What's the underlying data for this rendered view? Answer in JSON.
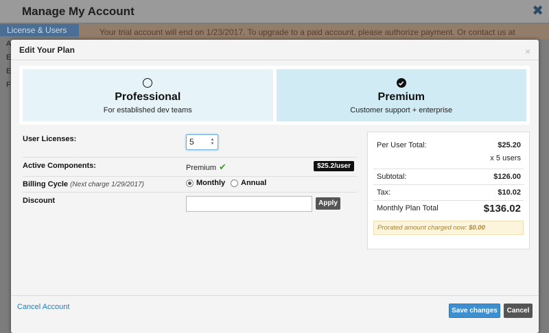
{
  "background": {
    "title": "Manage My Account",
    "close_glyph": "✖",
    "sidebar_active": "License & Users",
    "sidebar_letters": [
      "A",
      "E",
      "E",
      "F"
    ],
    "notice": "Your trial account will end on 1/23/2017. To upgrade to a paid account, please authorize payment. Or contact us at"
  },
  "modal": {
    "title": "Edit Your Plan",
    "close_glyph": "×"
  },
  "plans": [
    {
      "name": "Professional",
      "desc": "For established dev teams",
      "selected": false
    },
    {
      "name": "Premium",
      "desc": "Customer support + enterprise",
      "selected": true
    }
  ],
  "form": {
    "user_licenses_label": "User Licenses:",
    "user_licenses_value": "5",
    "active_components_label": "Active Components:",
    "active_components_value": "Premium",
    "price_badge": "$25.2/user",
    "billing_cycle_label": "Billing Cycle",
    "billing_cycle_note": "(Next charge 1/29/2017)",
    "billing_options": [
      "Monthly",
      "Annual"
    ],
    "billing_selected": "Monthly",
    "discount_label": "Discount",
    "discount_value": "",
    "apply_label": "Apply"
  },
  "summary": {
    "per_user_label": "Per User Total:",
    "per_user_value": "$25.20",
    "users_count": "x 5 users",
    "subtotal_label": "Subtotal:",
    "subtotal_value": "$126.00",
    "tax_label": "Tax:",
    "tax_value": "$10.02",
    "monthly_label": "Monthly Plan Total",
    "monthly_value": "$136.02",
    "prorated_label": "Prorated amount charged now:",
    "prorated_value": "$0.00"
  },
  "footer": {
    "cancel_account": "Cancel Account",
    "save": "Save changes",
    "cancel": "Cancel"
  },
  "colors": {
    "accent": "#3d8fd0",
    "plan_selected": "#d0ebf4",
    "plan_unselected": "#e6f3f8",
    "check_green": "#3a9a2a"
  }
}
